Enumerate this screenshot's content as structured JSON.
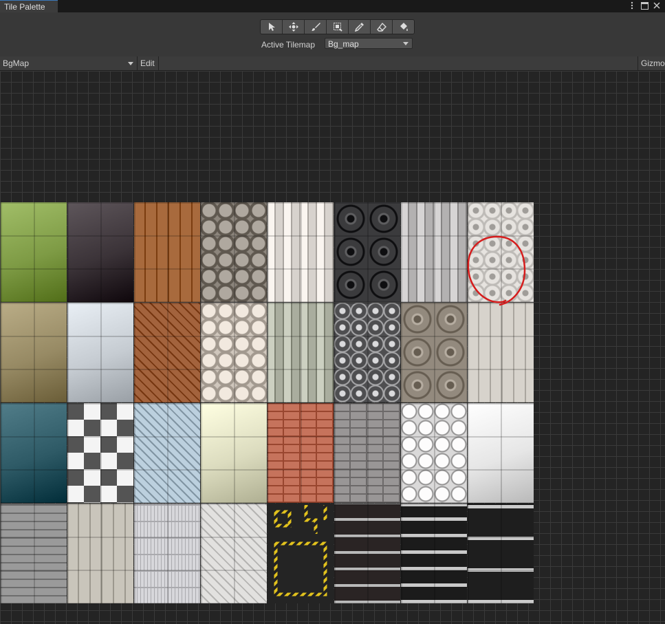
{
  "window": {
    "tab_label": "Tile Palette",
    "icons": [
      "more-options-icon",
      "maximize-icon",
      "close-icon"
    ]
  },
  "toolbar": {
    "tools": [
      {
        "name": "select-tool",
        "icon": "arrow-cursor-icon"
      },
      {
        "name": "move-tool",
        "icon": "move-icon"
      },
      {
        "name": "paint-tool",
        "icon": "brush-icon"
      },
      {
        "name": "box-fill-tool",
        "icon": "box-fill-icon"
      },
      {
        "name": "pick-tool",
        "icon": "eyedropper-icon"
      },
      {
        "name": "erase-tool",
        "icon": "eraser-icon"
      },
      {
        "name": "flood-fill-tool",
        "icon": "paint-bucket-icon"
      }
    ],
    "active_tilemap_label": "Active Tilemap",
    "active_tilemap_value": "Bg_map"
  },
  "palette_bar": {
    "palette_value": "BgMap",
    "edit_label": "Edit",
    "gizmos_label": "Gizmos"
  },
  "palette": {
    "tiles": [
      {
        "name": "grass",
        "base": "#7e9b45",
        "pattern": "plain"
      },
      {
        "name": "dark-stone",
        "base": "#3b3338",
        "pattern": "plain"
      },
      {
        "name": "wood-planks",
        "base": "#a86a3d",
        "pattern": "vplanks"
      },
      {
        "name": "octagon-stone",
        "base": "#8c857c",
        "pattern": "octagon"
      },
      {
        "name": "white-basketweave",
        "base": "#d7d2cd",
        "pattern": "weave"
      },
      {
        "name": "dark-ornate",
        "base": "#3b3b3d",
        "pattern": "circles"
      },
      {
        "name": "grey-basketweave",
        "base": "#b3b1b1",
        "pattern": "weave"
      },
      {
        "name": "white-floral",
        "base": "#e6e3df",
        "pattern": "floral"
      },
      {
        "name": "khaki-stone",
        "base": "#978a64",
        "pattern": "plain"
      },
      {
        "name": "light-marble",
        "base": "#c6ccd2",
        "pattern": "plain"
      },
      {
        "name": "herringbone-wood",
        "base": "#a3633d",
        "pattern": "diag"
      },
      {
        "name": "cream-octagon",
        "base": "#cfc6bc",
        "pattern": "octagon"
      },
      {
        "name": "green-basketweave",
        "base": "#a9ad9e",
        "pattern": "weave"
      },
      {
        "name": "dark-star-tile",
        "base": "#4e4e50",
        "pattern": "stars"
      },
      {
        "name": "taupe-medallion",
        "base": "#938a7e",
        "pattern": "circles"
      },
      {
        "name": "white-wood",
        "base": "#d7d3cc",
        "pattern": "vplanks"
      },
      {
        "name": "teal-carpet",
        "base": "#2e5a66",
        "pattern": "plain"
      },
      {
        "name": "checker-diamond",
        "base": "#9a9a9a",
        "pattern": "checker"
      },
      {
        "name": "blue-diamond",
        "base": "#bcd0de",
        "pattern": "diamond"
      },
      {
        "name": "cream-tile",
        "base": "#dcdcbf",
        "pattern": "plain"
      },
      {
        "name": "red-brick",
        "base": "#c6735c",
        "pattern": "brick"
      },
      {
        "name": "grey-brick",
        "base": "#999696",
        "pattern": "brick"
      },
      {
        "name": "white-hexagon",
        "base": "#dad9d9",
        "pattern": "hex"
      },
      {
        "name": "white-plain",
        "base": "#e6e6e6",
        "pattern": "plain"
      },
      {
        "name": "grey-planks",
        "base": "#9a9a9a",
        "pattern": "hplanks"
      },
      {
        "name": "pale-planks",
        "base": "#c9c5bb",
        "pattern": "vplanks"
      },
      {
        "name": "white-parquet",
        "base": "#d7d7db",
        "pattern": "parquet"
      },
      {
        "name": "white-herringbone",
        "base": "#e2e1df",
        "pattern": "diag"
      },
      {
        "name": "hazard-outline",
        "base": "#242424",
        "pattern": "hazard"
      },
      {
        "name": "bookshelf",
        "base": "#c4c4c4",
        "pattern": "shelf"
      },
      {
        "name": "metal-frame-dark",
        "base": "#c4c4c4",
        "pattern": "frames"
      },
      {
        "name": "metal-frame-light",
        "base": "#c4c4c4",
        "pattern": "frames2"
      }
    ],
    "highlight_color": "#d61c1c"
  }
}
